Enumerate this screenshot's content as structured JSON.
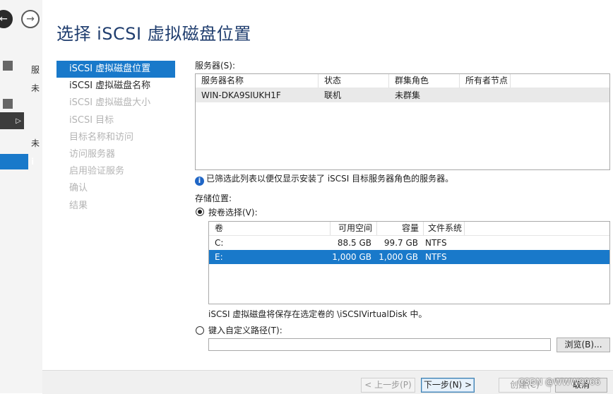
{
  "title": "选择 iSCSI 虚拟磁盘位置",
  "steps": [
    {
      "label": "iSCSI 虚拟磁盘位置",
      "state": "active"
    },
    {
      "label": "iSCSI 虚拟磁盘名称",
      "state": "done"
    },
    {
      "label": "iSCSI 虚拟磁盘大小",
      "state": "pending"
    },
    {
      "label": "iSCSI 目标",
      "state": "pending"
    },
    {
      "label": "目标名称和访问",
      "state": "pending"
    },
    {
      "label": "访问服务器",
      "state": "pending"
    },
    {
      "label": "启用验证服务",
      "state": "pending"
    },
    {
      "label": "确认",
      "state": "pending"
    },
    {
      "label": "结果",
      "state": "pending"
    }
  ],
  "server_section": {
    "label": "服务器(S):",
    "columns": [
      "服务器名称",
      "状态",
      "群集角色",
      "所有者节点"
    ],
    "rows": [
      {
        "name": "WIN-DKA9SIUKH1F",
        "status": "联机",
        "cluster_role": "未群集",
        "owner_node": ""
      }
    ],
    "info": "已筛选此列表以便仅显示安装了 iSCSI 目标服务器角色的服务器。"
  },
  "storage_section": {
    "label": "存储位置:",
    "by_volume_label": "按卷选择(V):",
    "columns": [
      "卷",
      "可用空间",
      "容量",
      "文件系统"
    ],
    "rows": [
      {
        "volume": "C:",
        "free": "88.5 GB",
        "capacity": "99.7 GB",
        "fs": "NTFS"
      },
      {
        "volume": "E:",
        "free": "1,000 GB",
        "capacity": "1,000 GB",
        "fs": "NTFS"
      }
    ],
    "save_note": "iSCSI 虚拟磁盘将保存在选定卷的 \\iSCSIVirtualDisk 中。",
    "custom_path_label": "键入自定义路径(T):",
    "custom_path_value": "",
    "browse_label": "浏览(B)..."
  },
  "buttons": {
    "prev": "< 上一步(P)",
    "next": "下一步(N) >",
    "create": "创建(C)",
    "cancel": "取消"
  },
  "background": {
    "glyph_1": "服",
    "glyph_2": "未",
    "glyph_3": "未",
    "glyph_4": "i"
  },
  "watermark": "CSDN @WWW9966",
  "colors": {
    "accent": "#1979ca",
    "title": "#1f3d6e"
  }
}
